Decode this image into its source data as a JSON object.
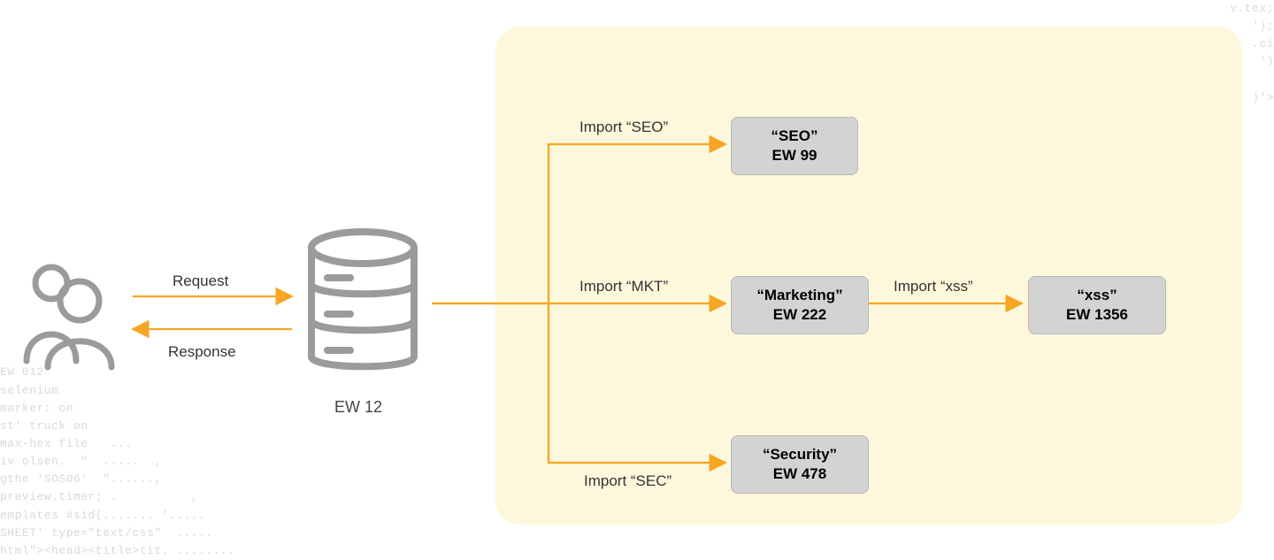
{
  "labels": {
    "request": "Request",
    "response": "Response",
    "import_seo": "Import “SEO”",
    "import_mkt": "Import “MKT”",
    "import_sec": "Import “SEC”",
    "import_xss": "Import “xss”"
  },
  "nodes": {
    "db": {
      "caption": "EW 12"
    },
    "seo": {
      "name": "“SEO”",
      "id": "EW 99"
    },
    "mkt": {
      "name": "“Marketing”",
      "id": "EW 222"
    },
    "sec": {
      "name": "“Security”",
      "id": "EW 478"
    },
    "xss": {
      "name": "“xss”",
      "id": "EW 1356"
    }
  },
  "colors": {
    "arrow": "#f5a623",
    "icon_stroke": "#9b9b9b"
  },
  "bg_code_left": "EW 012\nselenium\nmarker: on\nst' truck on\nmax-hex file   ...\niv olsen.  \"  .....  ,\ngthe 'SOS06'  \"......,\npreview.timer; .          ,\nemplates #sid(....... '.....\nSHEET' type=\"text/css\"  .....\nhtml\"><head><title>tit. ........",
  "bg_code_right": "v.tex;\n');\n.ci\n')\n\n)'>"
}
